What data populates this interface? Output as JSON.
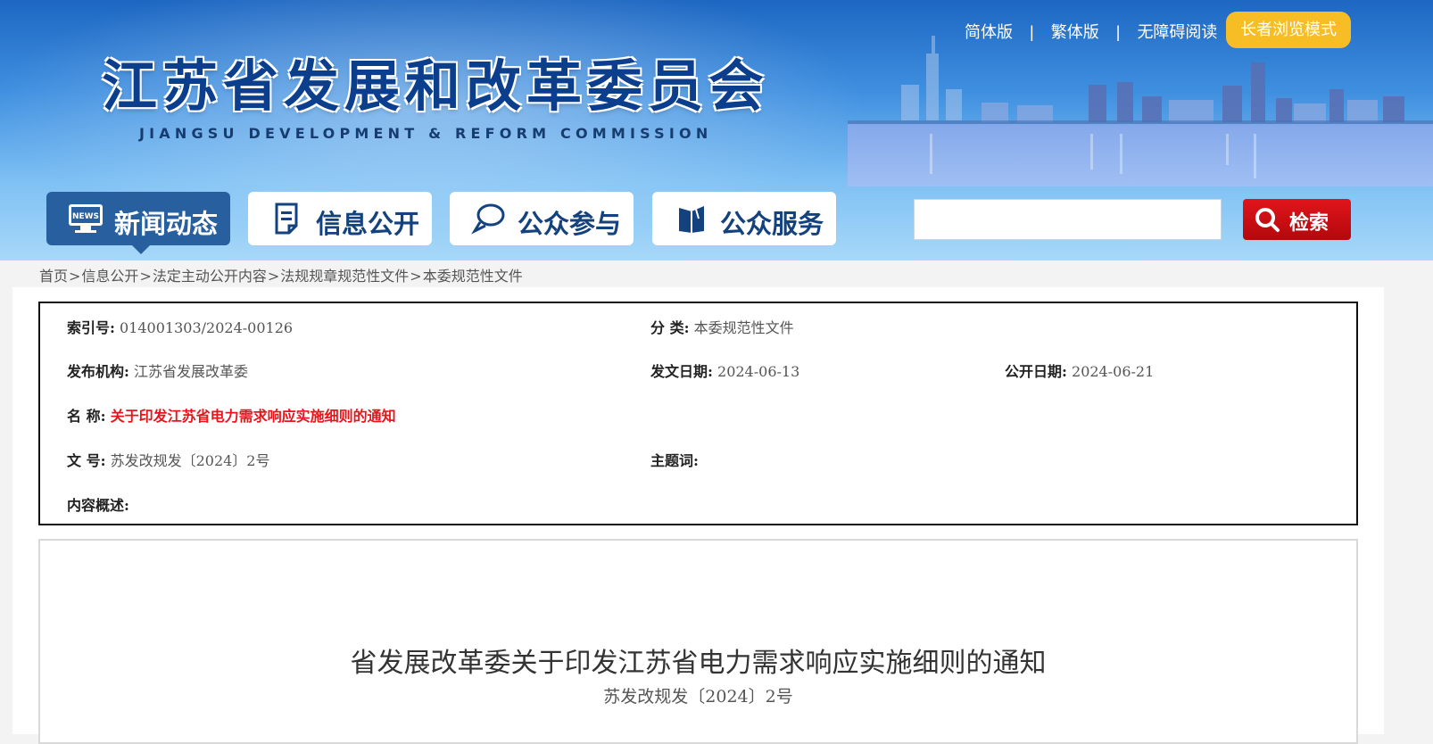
{
  "header": {
    "site_title": "江苏省发展和改革委员会",
    "site_subtitle": "JIANGSU DEVELOPMENT & REFORM COMMISSION",
    "links": [
      "简体版",
      "繁体版",
      "无障碍阅读"
    ],
    "link_separator": "|",
    "elder_mode": "长者浏览模式"
  },
  "nav": {
    "items": [
      {
        "label": "新闻动态",
        "icon": "news-icon",
        "active": true
      },
      {
        "label": "信息公开",
        "icon": "document-icon",
        "active": false
      },
      {
        "label": "公众参与",
        "icon": "chat-icon",
        "active": false
      },
      {
        "label": "公众服务",
        "icon": "book-icon",
        "active": false
      }
    ],
    "search_value": "",
    "search_button": "检索"
  },
  "breadcrumb": [
    "首页",
    "信息公开",
    "法定主动公开内容",
    "法规规章规范性文件",
    "本委规范性文件"
  ],
  "breadcrumb_separator": ">",
  "meta": {
    "index_no": {
      "label": "索引号:",
      "value": "014001303/2024-00126"
    },
    "category": {
      "label": "分  类:",
      "value": "本委规范性文件"
    },
    "publisher": {
      "label": "发布机构:",
      "value": "江苏省发展改革委"
    },
    "issue_date": {
      "label": "发文日期:",
      "value": "2024-06-13"
    },
    "publish_date": {
      "label": "公开日期:",
      "value": "2024-06-21"
    },
    "name": {
      "label": "名  称:",
      "value": "关于印发江苏省电力需求响应实施细则的通知"
    },
    "doc_no": {
      "label": "文  号:",
      "value": "苏发改规发〔2024〕2号"
    },
    "keywords": {
      "label": "主题词:",
      "value": ""
    },
    "summary": {
      "label": "内容概述:",
      "value": ""
    }
  },
  "article": {
    "title": "省发展改革委关于印发江苏省电力需求响应实施细则的通知",
    "doc_no": "苏发改规发〔2024〕2号"
  },
  "colors": {
    "brand_blue": "#28609f",
    "elder_yellow": "#f6bd25",
    "search_red": "#d0111a",
    "highlight_red": "#e8141c"
  }
}
